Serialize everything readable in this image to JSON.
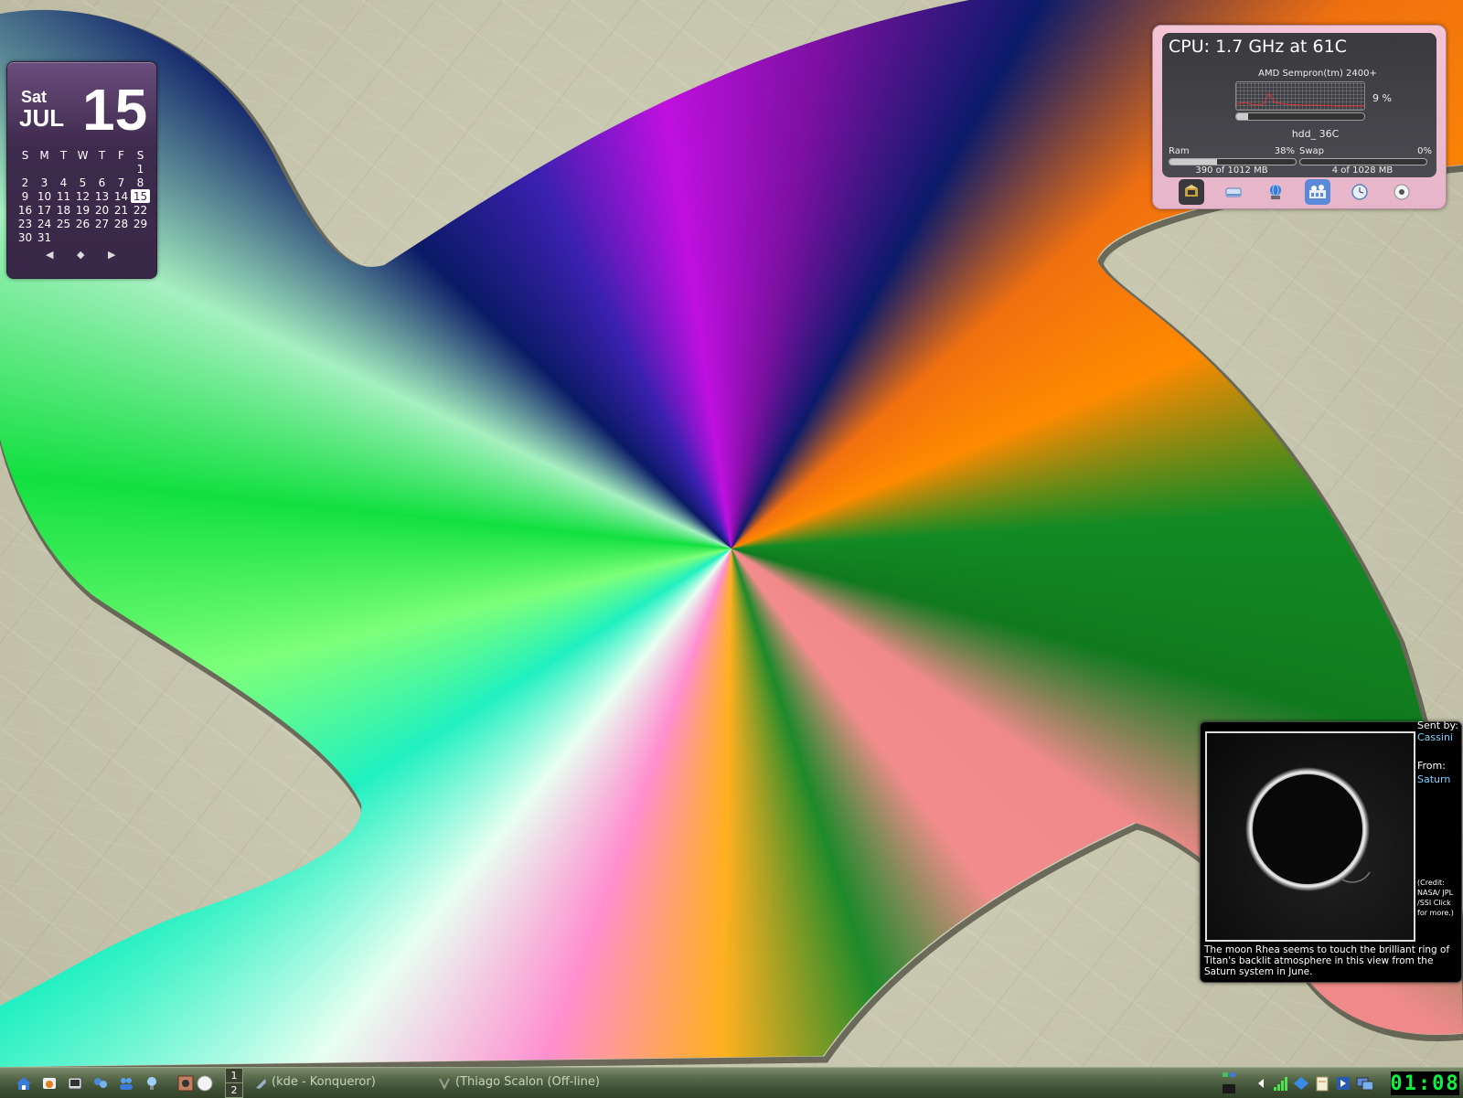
{
  "calendar": {
    "weekday": "Sat",
    "month": "JUL",
    "date": "15",
    "day_headers": [
      "S",
      "M",
      "T",
      "W",
      "T",
      "F",
      "S"
    ],
    "weeks": [
      [
        "",
        "",
        "",
        "",
        "",
        "",
        "1"
      ],
      [
        "2",
        "3",
        "4",
        "5",
        "6",
        "7",
        "8"
      ],
      [
        "9",
        "10",
        "11",
        "12",
        "13",
        "14",
        "15"
      ],
      [
        "16",
        "17",
        "18",
        "19",
        "20",
        "21",
        "22"
      ],
      [
        "23",
        "24",
        "25",
        "26",
        "27",
        "28",
        "29"
      ],
      [
        "30",
        "31",
        "",
        "",
        "",
        "",
        ""
      ]
    ],
    "today": "15",
    "nav": {
      "prev": "◀",
      "home": "◆",
      "next": "▶"
    }
  },
  "system_monitor": {
    "cpu_title": "CPU: 1.7 GHz at 61C",
    "cpu_model": "AMD Sempron(tm) 2400+",
    "cpu_percent_label": "9 %",
    "cpu_usage": 0.09,
    "hdd_temp": "hdd_ 36C",
    "ram_label": "Ram",
    "ram_percent": "38%",
    "ram_usage": 0.38,
    "ram_detail": "390 of 1012 MB",
    "swap_label": "Swap",
    "swap_percent": "0%",
    "swap_usage": 0.0,
    "swap_detail": "4 of 1028 MB",
    "tabs": [
      "cpu-chip-icon",
      "hard-drive-icon",
      "network-globe-icon",
      "memory-modules-icon",
      "clock-icon",
      "disc-icon"
    ]
  },
  "picture_frame": {
    "sent_by_label": "Sent by:",
    "sent_by": "Cassini",
    "from_label": "From:",
    "from": "Saturn",
    "credit": "(Credit: NASA/ JPL /SSI Click for more.)",
    "caption": "The moon Rhea seems to touch the brilliant ring of Titan's backlit atmosphere in this view from the Saturn system in June."
  },
  "taskbar": {
    "pager": [
      "1",
      "2"
    ],
    "tasks": [
      {
        "label": "(kde - Konqueror)"
      },
      {
        "label": "(Thiago Scalon (Off-line)"
      }
    ],
    "clock": "01:08",
    "colors": {
      "clock_digits": "#10f040"
    }
  }
}
